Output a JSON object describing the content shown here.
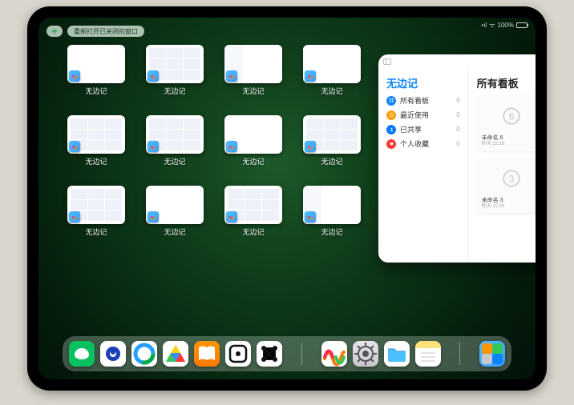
{
  "statusbar": {
    "signal": "•••",
    "wifi": "⌔",
    "battery": "100%"
  },
  "topbar": {
    "plus_label": "+",
    "pill_label": "重新打开已关闭的窗口"
  },
  "thumbs": [
    {
      "label": "无边记",
      "variant": "blank"
    },
    {
      "label": "无边记",
      "variant": "grid"
    },
    {
      "label": "无边记",
      "variant": "panel"
    },
    {
      "label": "无边记",
      "variant": "blank"
    },
    {
      "label": "无边记",
      "variant": "grid"
    },
    {
      "label": "无边记",
      "variant": "grid"
    },
    {
      "label": "无边记",
      "variant": "blank"
    },
    {
      "label": "无边记",
      "variant": "grid"
    },
    {
      "label": "无边记",
      "variant": "grid"
    },
    {
      "label": "无边记",
      "variant": "blank"
    },
    {
      "label": "无边记",
      "variant": "grid"
    },
    {
      "label": "无边记",
      "variant": "panel"
    }
  ],
  "bigwin": {
    "left_title": "无边记",
    "right_title": "所有看板",
    "items": [
      {
        "label": "所有看板",
        "count": 0,
        "color": "#0a84ff",
        "glyph": "grid"
      },
      {
        "label": "最近使用",
        "count": 0,
        "color": "#ff9f0a",
        "glyph": "clock"
      },
      {
        "label": "已共享",
        "count": 0,
        "color": "#007aff",
        "glyph": "person"
      },
      {
        "label": "个人收藏",
        "count": 0,
        "color": "#ff3b30",
        "glyph": "heart"
      }
    ],
    "boards": [
      {
        "title": "未命名 6",
        "subtitle": "昨天 11:28",
        "digit": "6"
      },
      {
        "title": "未命名 3",
        "subtitle": "昨天 11:25",
        "digit": "3"
      }
    ]
  },
  "dock": [
    {
      "name": "wechat",
      "cls": "di-wechat"
    },
    {
      "name": "quark",
      "cls": "di-qb"
    },
    {
      "name": "qqbrowser",
      "cls": "di-qq"
    },
    {
      "name": "baidu-cloud",
      "cls": "di-cloud"
    },
    {
      "name": "books",
      "cls": "di-books"
    },
    {
      "name": "dice",
      "cls": "di-die"
    },
    {
      "name": "graph",
      "cls": "di-graph"
    },
    {
      "name": "freeform",
      "cls": "di-freeform"
    },
    {
      "name": "settings",
      "cls": "di-settings"
    },
    {
      "name": "files",
      "cls": "di-files"
    },
    {
      "name": "notes",
      "cls": "di-notes"
    },
    {
      "name": "app-library",
      "cls": "di-folder"
    }
  ]
}
